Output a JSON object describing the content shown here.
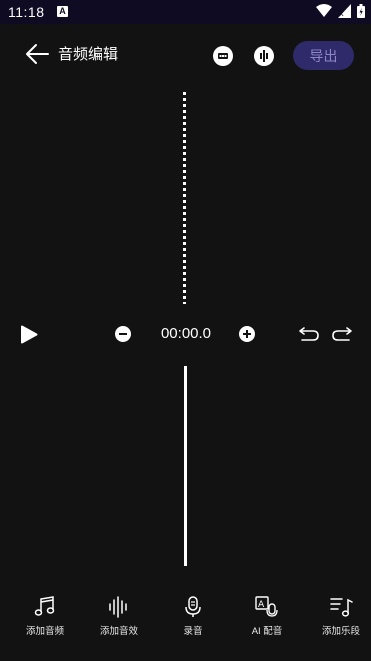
{
  "status": {
    "time": "11:18",
    "notif": "A"
  },
  "header": {
    "title": "音频编辑",
    "export_label": "导出"
  },
  "editor": {
    "time": "00:00.0"
  },
  "tools": [
    {
      "label": "添加音频",
      "icon": "music-note-icon"
    },
    {
      "label": "添加音效",
      "icon": "waveform-icon"
    },
    {
      "label": "录音",
      "icon": "microphone-icon"
    },
    {
      "label": "AI 配音",
      "icon": "ai-voice-icon"
    },
    {
      "label": "添加乐段",
      "icon": "music-list-icon"
    }
  ]
}
